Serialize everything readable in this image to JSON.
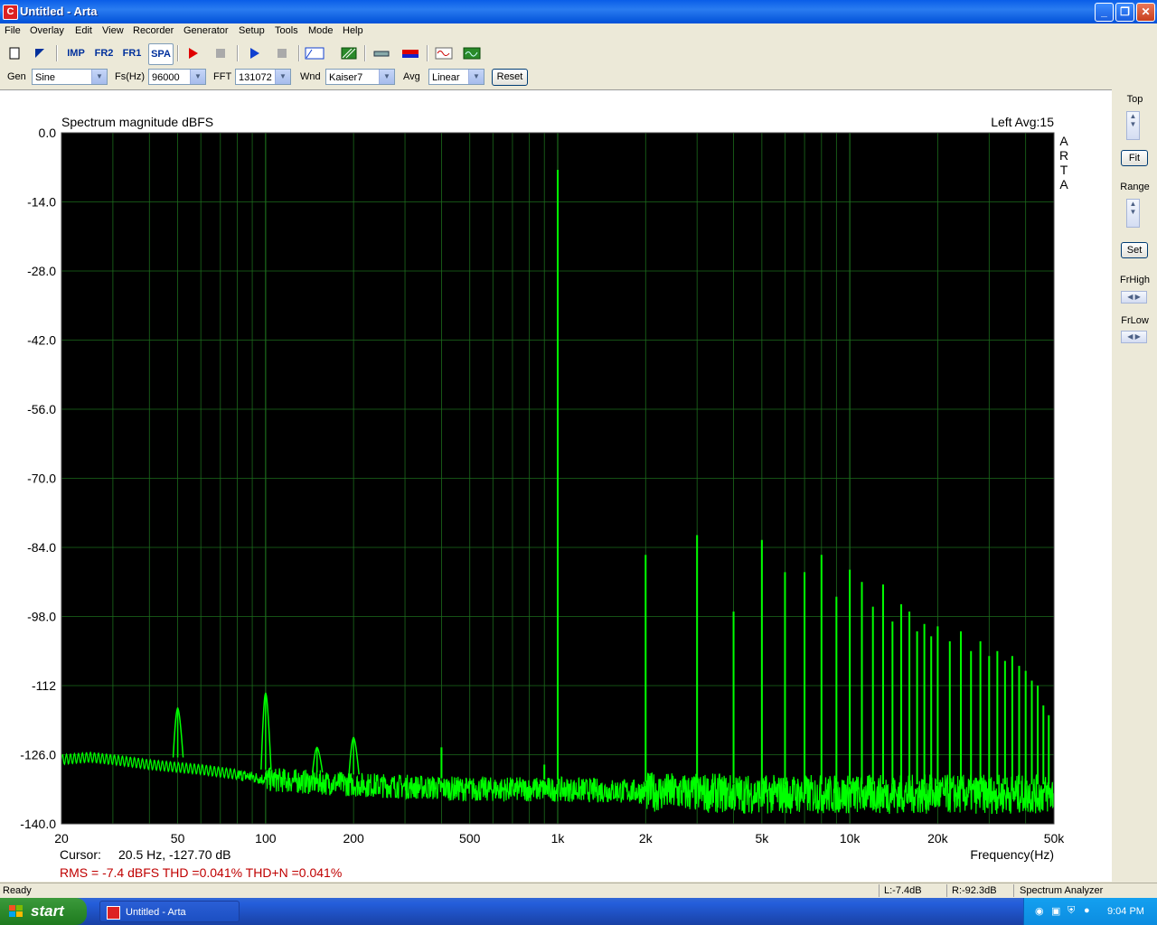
{
  "window": {
    "title": "Untitled - Arta",
    "app_icon": "C"
  },
  "menu": [
    "File",
    "Overlay",
    "Edit",
    "View",
    "Recorder",
    "Generator",
    "Setup",
    "Tools",
    "Mode",
    "Help"
  ],
  "toolbar": {
    "imp_label": "IMP",
    "fr2_label": "FR2",
    "fr1_label": "FR1",
    "spa_label": "SPA",
    "icons": [
      "new-file-icon",
      "open-icon",
      "record-icon",
      "stop-icon",
      "play-icon",
      "stop-play-icon",
      "abc-icon",
      "hatch-icon",
      "probe-icon",
      "flag-icon",
      "sine-icon",
      "signal-icon"
    ]
  },
  "params": {
    "gen_label": "Gen",
    "gen_value": "Sine",
    "fs_label": "Fs(Hz)",
    "fs_value": "96000",
    "fft_label": "FFT",
    "fft_value": "131072",
    "wnd_label": "Wnd",
    "wnd_value": "Kaiser7",
    "avg_label": "Avg",
    "avg_value": "Linear",
    "reset_label": "Reset"
  },
  "right_panel": {
    "top_label": "Top",
    "fit_label": "Fit",
    "range_label": "Range",
    "set_label": "Set",
    "frhigh_label": "FrHigh",
    "frlow_label": "FrLow"
  },
  "plot_info": {
    "header_right": "Left  Avg:15",
    "side_label": [
      "A",
      "R",
      "T",
      "A"
    ],
    "cursor_label": "Cursor:",
    "cursor_value": "20.5 Hz, -127.70 dB",
    "rms_text": "RMS =   -7.4 dBFS   THD =0.041%   THD+N =0.041%",
    "rms_color": "#c00000"
  },
  "chart_data": {
    "type": "line",
    "title": "Spectrum magnitude dBFS",
    "xlabel": "Frequency(Hz)",
    "ylabel": "",
    "xscale": "log",
    "xlim": [
      20,
      50000
    ],
    "ylim": [
      -140,
      0
    ],
    "x_ticks": [
      {
        "v": 20,
        "label": "20"
      },
      {
        "v": 50,
        "label": "50"
      },
      {
        "v": 100,
        "label": "100"
      },
      {
        "v": 200,
        "label": "200"
      },
      {
        "v": 500,
        "label": "500"
      },
      {
        "v": 1000,
        "label": "1k"
      },
      {
        "v": 2000,
        "label": "2k"
      },
      {
        "v": 5000,
        "label": "5k"
      },
      {
        "v": 10000,
        "label": "10k"
      },
      {
        "v": 20000,
        "label": "20k"
      },
      {
        "v": 50000,
        "label": "50k"
      }
    ],
    "y_ticks": [
      {
        "v": 0,
        "label": "0.0"
      },
      {
        "v": -14,
        "label": "-14.0"
      },
      {
        "v": -28,
        "label": "-28.0"
      },
      {
        "v": -42,
        "label": "-42.0"
      },
      {
        "v": -56,
        "label": "-56.0"
      },
      {
        "v": -70,
        "label": "-70.0"
      },
      {
        "v": -84,
        "label": "-84.0"
      },
      {
        "v": -98,
        "label": "-98.0"
      },
      {
        "v": -112,
        "label": "-112"
      },
      {
        "v": -126,
        "label": "-126.0"
      },
      {
        "v": -140,
        "label": "-140.0"
      }
    ],
    "grid": true,
    "background": "#000000",
    "grid_color": "#1c6b1c",
    "line_color": "#00ff00",
    "series": [
      {
        "noise_floor": [
          [
            20,
            -127
          ],
          [
            25,
            -126.5
          ],
          [
            30,
            -127
          ],
          [
            40,
            -128
          ],
          [
            60,
            -129
          ],
          [
            80,
            -130
          ],
          [
            100,
            -131
          ],
          [
            200,
            -132
          ],
          [
            500,
            -133
          ],
          [
            1000,
            -133
          ],
          [
            2000,
            -133.5
          ],
          [
            5000,
            -134
          ],
          [
            10000,
            -134
          ],
          [
            20000,
            -134
          ],
          [
            50000,
            -134
          ]
        ],
        "peaks": [
          {
            "f": 50,
            "db": -116.5
          },
          {
            "f": 100,
            "db": -113.5
          },
          {
            "f": 150,
            "db": -124.5
          },
          {
            "f": 200,
            "db": -122.5
          },
          {
            "f": 400,
            "db": -124.5
          },
          {
            "f": 900,
            "db": -128
          },
          {
            "f": 1000,
            "db": -7.5
          },
          {
            "f": 2000,
            "db": -85.5
          },
          {
            "f": 3000,
            "db": -81.5
          },
          {
            "f": 4000,
            "db": -97
          },
          {
            "f": 5000,
            "db": -82.5
          },
          {
            "f": 6000,
            "db": -89
          },
          {
            "f": 7000,
            "db": -89
          },
          {
            "f": 8000,
            "db": -85.5
          },
          {
            "f": 9000,
            "db": -94
          },
          {
            "f": 10000,
            "db": -88.5
          },
          {
            "f": 11000,
            "db": -91
          },
          {
            "f": 12000,
            "db": -96
          },
          {
            "f": 13000,
            "db": -91.5
          },
          {
            "f": 14000,
            "db": -99
          },
          {
            "f": 15000,
            "db": -95.5
          },
          {
            "f": 16000,
            "db": -97
          },
          {
            "f": 17000,
            "db": -101
          },
          {
            "f": 18000,
            "db": -99.5
          },
          {
            "f": 19000,
            "db": -102
          },
          {
            "f": 20000,
            "db": -100
          },
          {
            "f": 22000,
            "db": -103
          },
          {
            "f": 24000,
            "db": -101
          },
          {
            "f": 26000,
            "db": -105
          },
          {
            "f": 28000,
            "db": -103
          },
          {
            "f": 30000,
            "db": -106
          },
          {
            "f": 32000,
            "db": -105
          },
          {
            "f": 34000,
            "db": -107
          },
          {
            "f": 36000,
            "db": -106
          },
          {
            "f": 38000,
            "db": -108
          },
          {
            "f": 40000,
            "db": -109
          },
          {
            "f": 42000,
            "db": -111
          },
          {
            "f": 44000,
            "db": -112
          },
          {
            "f": 46000,
            "db": -116
          },
          {
            "f": 48000,
            "db": -118
          }
        ]
      }
    ]
  },
  "status": {
    "ready": "Ready",
    "left_level": "L:-7.4dB",
    "right_level": "R:-92.3dB",
    "mode": "Spectrum Analyzer"
  },
  "taskbar": {
    "start_label": "start",
    "task_label": "Untitled - Arta",
    "clock": "9:04 PM"
  }
}
